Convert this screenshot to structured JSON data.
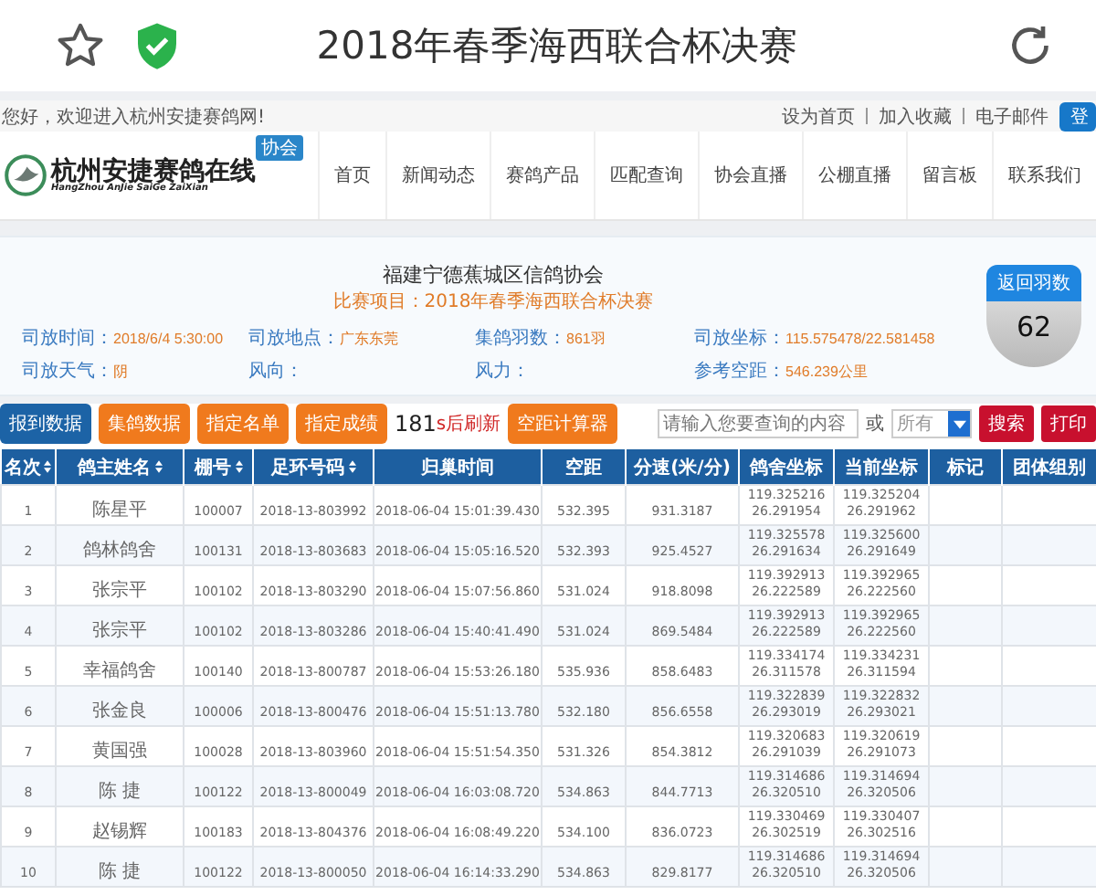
{
  "browser": {
    "title": "2018年春季海西联合杯决赛"
  },
  "top_strip": {
    "welcome": "您好，欢迎进入杭州安捷赛鸽网!",
    "links": [
      "设为首页",
      "加入收藏",
      "电子邮件"
    ],
    "login": "登"
  },
  "header": {
    "logo_title": "杭州安捷赛鸽在线",
    "logo_subtitle": "HangZhou AnJie SaiGe ZaiXian",
    "logo_badge": "协会",
    "nav": [
      {
        "label": "首页"
      },
      {
        "label": "新闻动态"
      },
      {
        "label": "赛鸽产品"
      },
      {
        "label": "匹配查询"
      },
      {
        "label": "协会直播"
      },
      {
        "label": "公棚直播"
      },
      {
        "label": "留言板"
      },
      {
        "label": "联系我们"
      }
    ]
  },
  "race": {
    "association": "福建宁德蕉城区信鸽协会",
    "event": "比赛项目：2018年春季海西联合杯决赛",
    "info": [
      {
        "label": "司放时间：",
        "value": "2018/6/4 5:30:00"
      },
      {
        "label": "司放地点：",
        "value": "广东东莞"
      },
      {
        "label": "集鸽羽数：",
        "value": "861羽"
      },
      {
        "label": "司放坐标：",
        "value": "115.575478/22.581458"
      },
      {
        "label": "司放天气：",
        "value": "阴"
      },
      {
        "label": "风向："
      },
      {
        "label": "风力："
      },
      {
        "label": "参考空距：",
        "value": "546.239公里"
      }
    ],
    "returned_label": "返回羽数",
    "returned_count": "62"
  },
  "toolbar": {
    "tabs": [
      {
        "label": "报到数据",
        "selected": true
      },
      {
        "label": "集鸽数据",
        "selected": false
      },
      {
        "label": "指定名单",
        "selected": false
      },
      {
        "label": "指定成绩",
        "selected": false
      }
    ],
    "countdown": "181",
    "countdown_note": "s后刷新",
    "calculator": "空距计算器",
    "search_placeholder": "请输入您要查询的内容",
    "or": "或",
    "filter": "所有",
    "search": "搜索",
    "print": "打印"
  },
  "table": {
    "columns": [
      {
        "label": "名次",
        "sortable": true
      },
      {
        "label": "鸽主姓名",
        "sortable": true
      },
      {
        "label": "棚号",
        "sortable": true
      },
      {
        "label": "足环号码",
        "sortable": true
      },
      {
        "label": "归巢时间",
        "sortable": false
      },
      {
        "label": "空距",
        "sortable": false
      },
      {
        "label": "分速(米/分)",
        "sortable": false
      },
      {
        "label": "鸽舍坐标",
        "sortable": false
      },
      {
        "label": "当前坐标",
        "sortable": false
      },
      {
        "label": "标记",
        "sortable": false
      },
      {
        "label": "团体组别",
        "sortable": false
      }
    ],
    "rows": [
      [
        "1",
        "陈星平",
        "100007",
        "2018-13-803992",
        "2018-06-04 15:01:39.430",
        "532.395",
        "931.3187",
        "119.325216\n26.291954",
        "119.325204\n26.291962"
      ],
      [
        "2",
        "鸽林鸽舍",
        "100131",
        "2018-13-803683",
        "2018-06-04 15:05:16.520",
        "532.393",
        "925.4527",
        "119.325578\n26.291634",
        "119.325600\n26.291649"
      ],
      [
        "3",
        "张宗平",
        "100102",
        "2018-13-803290",
        "2018-06-04 15:07:56.860",
        "531.024",
        "918.8098",
        "119.392913\n26.222589",
        "119.392965\n26.222560"
      ],
      [
        "4",
        "张宗平",
        "100102",
        "2018-13-803286",
        "2018-06-04 15:40:41.490",
        "531.024",
        "869.5484",
        "119.392913\n26.222589",
        "119.392965\n26.222560"
      ],
      [
        "5",
        "幸福鸽舍",
        "100140",
        "2018-13-800787",
        "2018-06-04 15:53:26.180",
        "535.936",
        "858.6483",
        "119.334174\n26.311578",
        "119.334231\n26.311594"
      ],
      [
        "6",
        "张金良",
        "100006",
        "2018-13-800476",
        "2018-06-04 15:51:13.780",
        "532.180",
        "856.6558",
        "119.322839\n26.293019",
        "119.322832\n26.293021"
      ],
      [
        "7",
        "黄国强",
        "100028",
        "2018-13-803960",
        "2018-06-04 15:51:54.350",
        "531.326",
        "854.3812",
        "119.320683\n26.291039",
        "119.320619\n26.291073"
      ],
      [
        "8",
        "陈 捷",
        "100122",
        "2018-13-800049",
        "2018-06-04 16:03:08.720",
        "534.863",
        "844.7713",
        "119.314686\n26.320510",
        "119.314694\n26.320506"
      ],
      [
        "9",
        "赵锡辉",
        "100183",
        "2018-13-804376",
        "2018-06-04 16:08:49.220",
        "534.100",
        "836.0723",
        "119.330469\n26.302519",
        "119.330407\n26.302516"
      ],
      [
        "10",
        "陈 捷",
        "100122",
        "2018-13-800050",
        "2018-06-04 16:14:33.290",
        "534.863",
        "829.8177",
        "119.314686\n26.320510",
        "119.314694\n26.320506"
      ]
    ]
  }
}
